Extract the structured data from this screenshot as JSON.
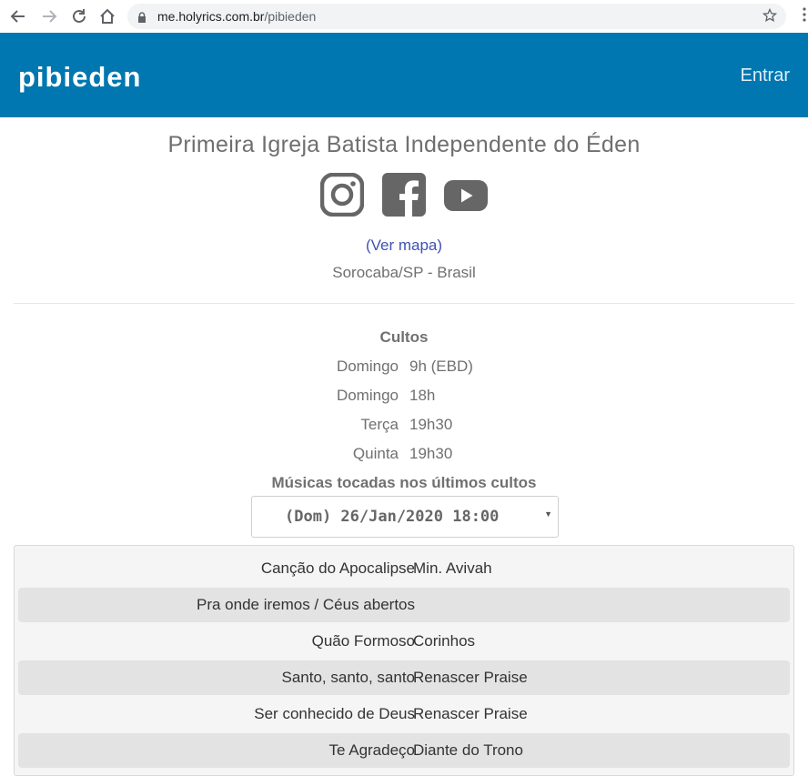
{
  "browser": {
    "url_host": "me.holyrics.com.br",
    "url_path": "/pibieden"
  },
  "header": {
    "brand": "pibieden",
    "login_label": "Entrar"
  },
  "church": {
    "name": "Primeira Igreja Batista Independente do Éden",
    "socials": [
      "instagram-icon",
      "facebook-icon",
      "youtube-icon"
    ],
    "map_link": "(Ver mapa)",
    "location": "Sorocaba/SP - Brasil"
  },
  "services": {
    "title": "Cultos",
    "rows": [
      {
        "day": "Domingo",
        "time": "9h (EBD)"
      },
      {
        "day": "Domingo",
        "time": "18h"
      },
      {
        "day": "Terça",
        "time": "19h30"
      },
      {
        "day": "Quinta",
        "time": "19h30"
      }
    ]
  },
  "songs": {
    "title": "Músicas tocadas nos últimos cultos",
    "selected_service": "(Dom) 26/Jan/2020 18:00",
    "rows": [
      {
        "title": "Canção do Apocalipse",
        "artist": "Min. Avivah"
      },
      {
        "title": "Pra onde iremos / Céus abertos",
        "artist": ""
      },
      {
        "title": "Quão Formoso",
        "artist": "Corinhos"
      },
      {
        "title": "Santo, santo, santo",
        "artist": "Renascer Praise"
      },
      {
        "title": "Ser conhecido de Deus",
        "artist": "Renascer Praise"
      },
      {
        "title": "Te Agradeço",
        "artist": "Diante do Trono"
      }
    ]
  },
  "colors": {
    "header_bg": "#0077b0",
    "link": "#3f51b5",
    "icon": "#666666"
  }
}
